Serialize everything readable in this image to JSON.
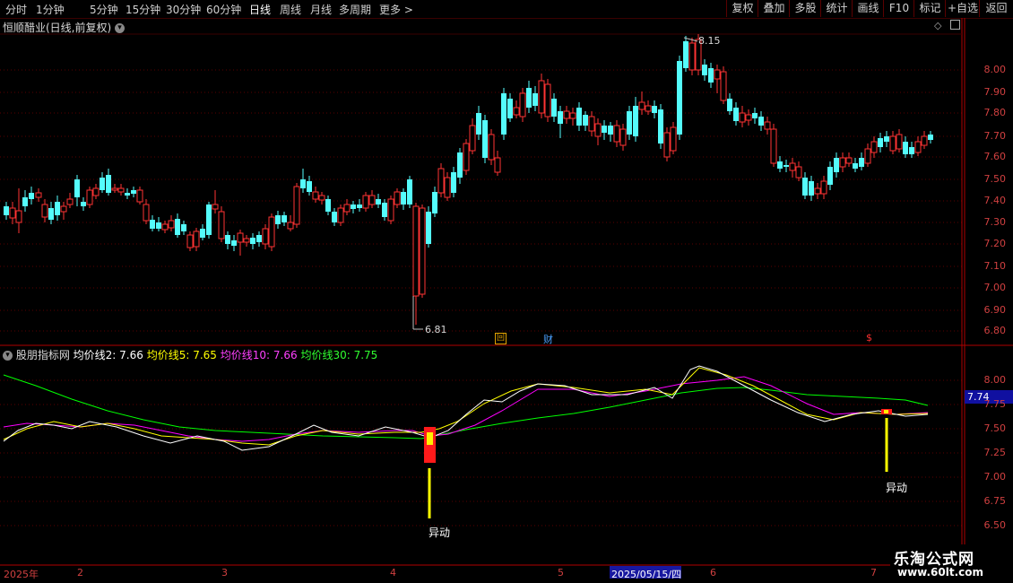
{
  "toolbar": {
    "periods": [
      "分时",
      "1分钟",
      "5分钟",
      "15分钟",
      "30分钟",
      "60分钟",
      "日线",
      "周线",
      "月线",
      "多周期",
      "更多"
    ],
    "active_period": "日线",
    "more_icon": "chevron-right-icon",
    "right_buttons": [
      "复权",
      "叠加",
      "多股",
      "统计",
      "画线",
      "F10",
      "标记",
      "+自选",
      "返回"
    ]
  },
  "main_chart": {
    "title": "恒顺醋业(日线,前复权)",
    "high_marker": "8.15",
    "low_marker": "6.81",
    "event_labels": [
      "回",
      "财",
      "$"
    ],
    "y_ticks": [
      "8.00",
      "7.90",
      "7.80",
      "7.70",
      "7.60",
      "7.50",
      "7.40",
      "7.30",
      "7.20",
      "7.10",
      "7.00",
      "6.90",
      "6.80"
    ]
  },
  "indicator": {
    "name": "股朋指标网",
    "ma2_label": "均价线2: 7.66",
    "ma5_label": "均价线5: 7.65",
    "ma10_label": "均价线10: 7.66",
    "ma30_label": "均价线30: 7.75",
    "current_value": "7.74",
    "y_ticks": [
      "8.00",
      "7.75",
      "7.50",
      "7.25",
      "7.00",
      "6.75",
      "6.50"
    ],
    "signal_label": "异动",
    "colors": {
      "ma2": "#ffffff",
      "ma5": "#ffff00",
      "ma10": "#ff00ff",
      "ma30": "#00ff00"
    }
  },
  "x_axis": {
    "labels": [
      "2025年",
      "2",
      "3",
      "4",
      "5",
      "2025/05/15/四",
      "6",
      "7"
    ]
  },
  "colors": {
    "up": "#ff3333",
    "down": "#54fcfc",
    "axis": "#b00000"
  },
  "watermark": {
    "title": "乐淘公式网",
    "url": "www.60lt.com"
  }
}
